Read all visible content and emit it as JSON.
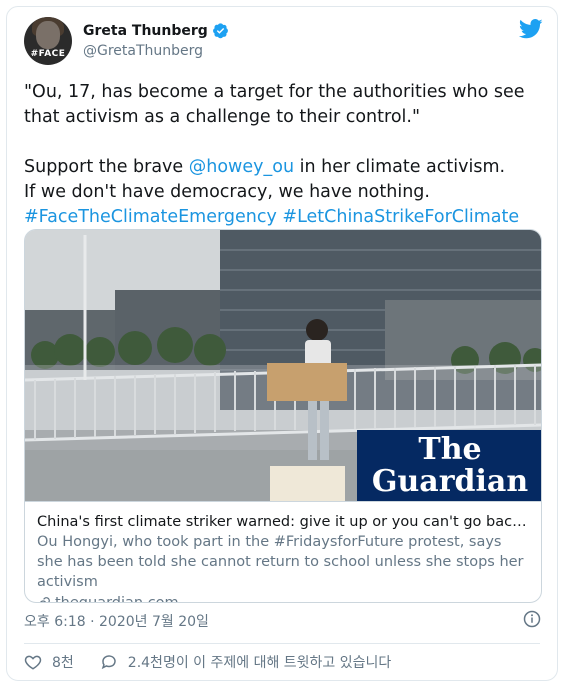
{
  "author": {
    "name": "Greta Thunberg",
    "handle": "@GretaThunberg",
    "avatar_badge": "#FACE"
  },
  "tweet": {
    "line1": "\"Ou, 17, has become a target for the authorities who see",
    "line2": "that activism as a challenge to their control.\"",
    "line3_prefix": "Support the brave ",
    "mention": "@howey_ou",
    "line3_suffix": " in her climate activism.",
    "line4": "If we don't have democracy, we have nothing.",
    "hashtag1": "#FaceTheClimateEmergency",
    "hashtag2": "#LetChinaStrikeForClimate"
  },
  "card": {
    "title": "China's first climate striker warned: give it up or you can't go back to ...",
    "description": "Ou Hongyi, who took part in the #FridaysforFuture protest, says she has been told she cannot return to school unless she stops her activism",
    "domain": "theguardian.com",
    "logo_line1": "The",
    "logo_line2": "Guardian",
    "brand_color": "#052962"
  },
  "timestamp": "오후 6:18 · 2020년 7월 20일",
  "actions": {
    "likes": "8천",
    "conversation": "2.4천명이 이 주제에 대해 트윗하고 있습니다"
  },
  "colors": {
    "link": "#1b95e0",
    "twitter_blue": "#1da1f2",
    "secondary_text": "#657786"
  },
  "icons": [
    "verified-badge-icon",
    "twitter-bird-icon",
    "link-icon",
    "info-icon",
    "heart-icon",
    "comment-bubble-icon"
  ]
}
